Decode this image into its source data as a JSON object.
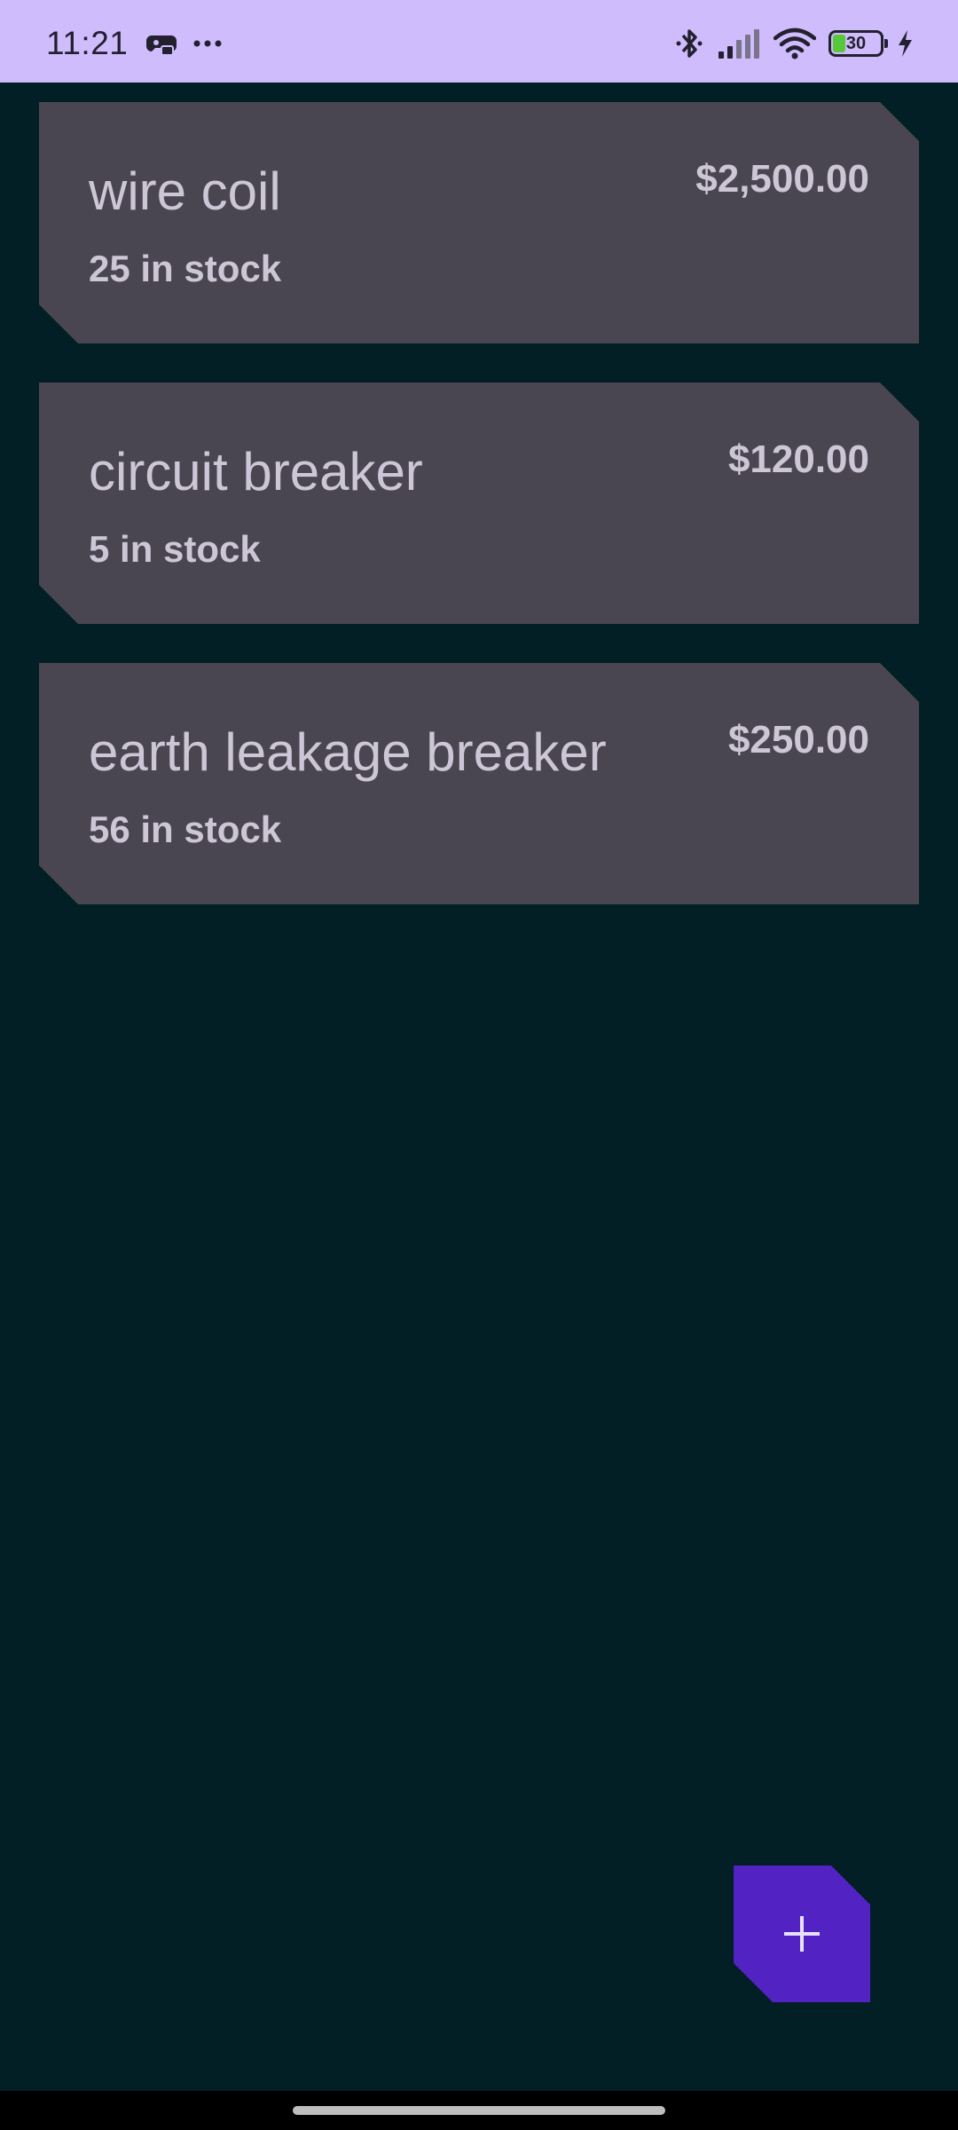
{
  "status_bar": {
    "time": "11:21",
    "battery_level": "30",
    "icons": [
      "game-controller-icon",
      "more-dots-icon",
      "bluetooth-icon",
      "cellular-signal-icon",
      "wifi-icon",
      "battery-icon",
      "charging-bolt-icon"
    ],
    "background_color": "#cfbcfd"
  },
  "inventory": {
    "items": [
      {
        "name": "wire coil",
        "price": "$2,500.00",
        "stock": "25 in stock"
      },
      {
        "name": "circuit breaker",
        "price": "$120.00",
        "stock": "5 in stock"
      },
      {
        "name": "earth leakage breaker",
        "price": "$250.00",
        "stock": "56 in stock"
      }
    ],
    "card_color": "#4a4651",
    "text_color": "#cdc6d6"
  },
  "fab": {
    "icon": "plus-icon",
    "color": "#5222c2"
  },
  "background_color": "#011f24"
}
